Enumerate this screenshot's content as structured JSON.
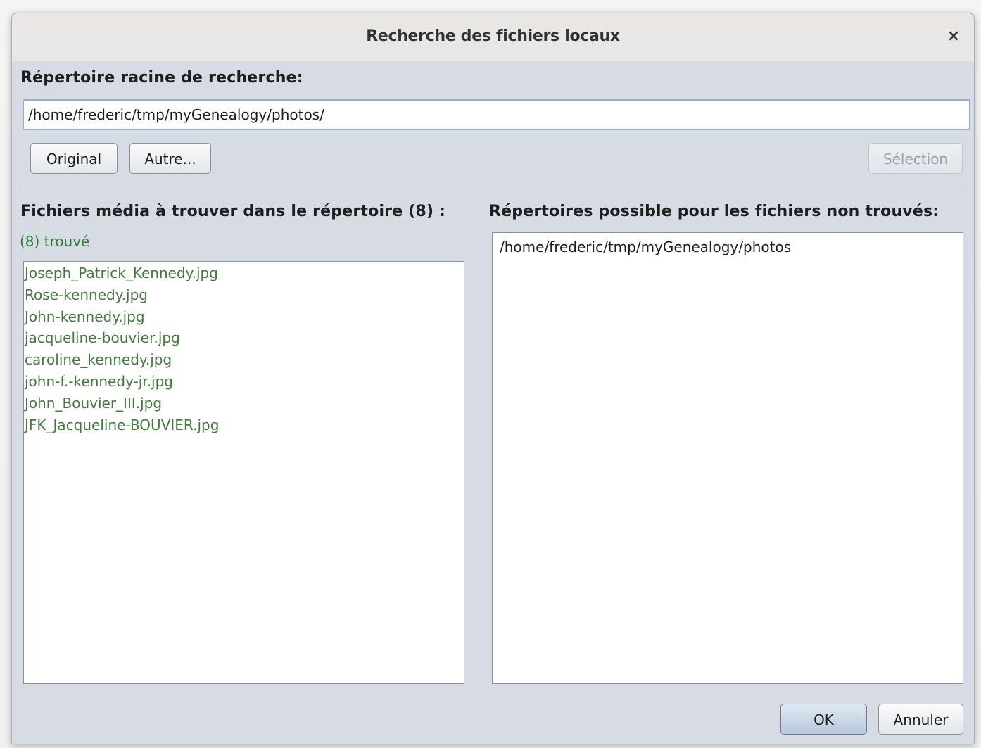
{
  "window": {
    "title": "Recherche des fichiers locaux",
    "close_glyph": "×"
  },
  "root_dir": {
    "label": "Répertoire racine de recherche:",
    "value": "/home/frederic/tmp/myGenealogy/photos/"
  },
  "buttons": {
    "original": "Original",
    "other": "Autre...",
    "selection": "Sélection",
    "ok": "OK",
    "cancel": "Annuler"
  },
  "media_files": {
    "label": "Fichiers média à trouver dans le répertoire (8) :",
    "found_label": "(8) trouvé",
    "items": [
      "Joseph_Patrick_Kennedy.jpg",
      "Rose-kennedy.jpg",
      "John-kennedy.jpg",
      "jacqueline-bouvier.jpg",
      "caroline_kennedy.jpg",
      "john-f.-kennedy-jr.jpg",
      "John_Bouvier_III.jpg",
      "JFK_Jacqueline-BOUVIER.jpg"
    ]
  },
  "possible_dirs": {
    "label": "Répertoires possible pour les fichiers non trouvés:",
    "items": [
      "/home/frederic/tmp/myGenealogy/photos"
    ]
  },
  "colors": {
    "found_text": "#3f7c3a",
    "dialog_bg": "#d6dbe4",
    "titlebar_bg": "#e9e7e5",
    "input_focus_border": "#8eb0d6"
  }
}
